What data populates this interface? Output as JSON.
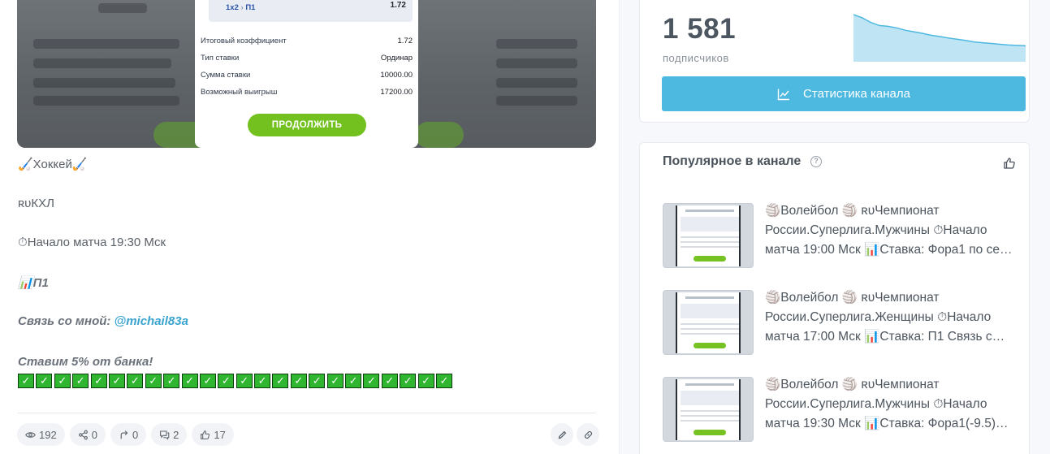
{
  "post": {
    "bet_slip": {
      "market": "1x2",
      "arrow": "›",
      "selection": "П1",
      "odds": "1.72",
      "rows": [
        {
          "label": "Итоговый коэффициент",
          "value": "1.72"
        },
        {
          "label": "Тип ставки",
          "value": "Ординар"
        },
        {
          "label": "Сумма ставки",
          "value": "10000.00"
        },
        {
          "label": "Возможный выигрыш",
          "value": "17200.00"
        }
      ],
      "button_label": "ПРОДОЛЖИТЬ"
    },
    "line_sport": "🏑Хоккей🏑",
    "line_league": "ʀᴜКХЛ",
    "line_time": "⏱Начало матча 19:30 Мск",
    "line_bet": "📊П1",
    "contact_prefix": "Связь со мной: ",
    "contact_link": "@michail83a",
    "bank_text": "Ставим 5% от банка!",
    "check_glyph": "✓",
    "check_count": 24
  },
  "stats": {
    "views": "192",
    "shares": "0",
    "forwards": "0",
    "comments": "2",
    "likes": "17"
  },
  "channel": {
    "subscribers_count": "1 581",
    "subscribers_label": "подписчиков",
    "stats_button_label": "Статистика канала",
    "trend_values": [
      100,
      92,
      80,
      72,
      70,
      66,
      60,
      56,
      52,
      47,
      44,
      40,
      37,
      34,
      30,
      28,
      26,
      24,
      22,
      21,
      20
    ]
  },
  "popular": {
    "title": "Популярное в канале",
    "help_glyph": "?",
    "items": [
      {
        "text": "🏐Волейбол 🏐 ʀᴜЧемпионат России.Суперлига.Мужчины ⏱Начало матча 19:00 Мск 📊Ставка: Фора1 по се…"
      },
      {
        "text": "🏐Волейбол 🏐 ʀᴜЧемпионат России.Суперлига.Женщины ⏱Начало матча 17:00 Мск 📊Ставка: П1 Связь с…"
      },
      {
        "text": "🏐Волейбол 🏐 ʀᴜЧемпионат России.Суперлига.Мужчины ⏱Начало матча 19:30 Мск 📊Ставка: Фора1(-9.5)…"
      }
    ]
  },
  "colors": {
    "accent": "#4db8e0",
    "link": "#3aa4cf",
    "continue_green": "#73c11e"
  }
}
